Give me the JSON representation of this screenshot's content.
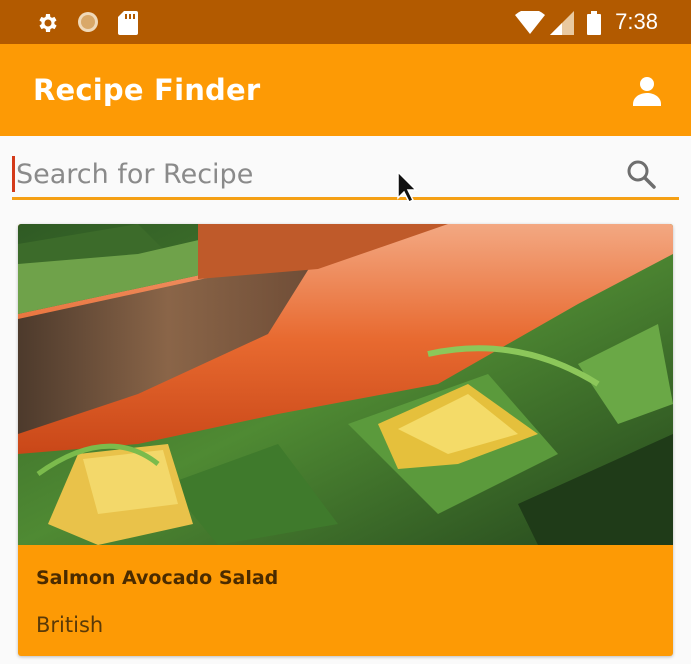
{
  "status_bar": {
    "time": "7:38",
    "icons": [
      "settings-icon",
      "circle-icon",
      "sd-card-icon",
      "wifi-icon",
      "signal-icon",
      "battery-icon"
    ]
  },
  "app_bar": {
    "title": "Recipe Finder",
    "account_icon": "person-icon"
  },
  "search": {
    "placeholder": "Search for Recipe",
    "value": "",
    "icon": "search-icon"
  },
  "recipes": [
    {
      "title": "Salmon Avocado Salad",
      "cuisine": "British"
    }
  ],
  "colors": {
    "status_bar": "#b25a00",
    "primary": "#fd9a05",
    "accent": "#f5a014"
  }
}
